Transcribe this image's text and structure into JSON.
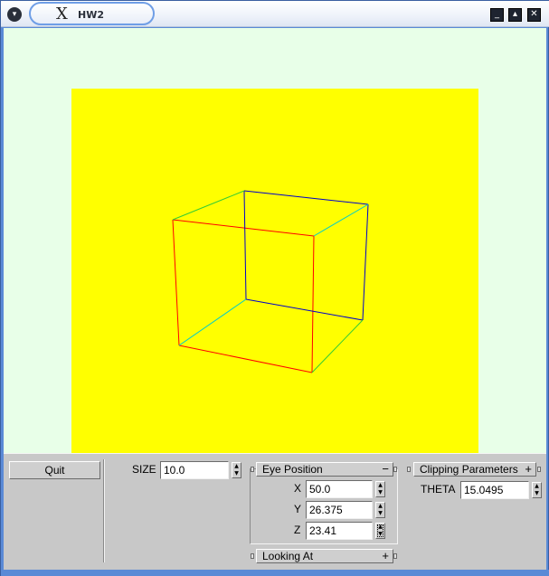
{
  "window": {
    "title": "HW2",
    "x_logo": "X",
    "menu_glyph": "▾",
    "min_glyph": "_",
    "max_glyph": "▴",
    "close_glyph": "✕"
  },
  "colors": {
    "background": "#e8ffe8",
    "viewport": "#ffff00",
    "edge_red": "#ff0000",
    "edge_blue": "#0000cc",
    "edge_green": "#33cc33",
    "edge_cyan": "#00cccc"
  },
  "controls": {
    "quit_label": "Quit",
    "size_label": "SIZE",
    "size_value": "10.0",
    "eye_position": {
      "title": "Eye Position",
      "sign": "−",
      "x_label": "X",
      "x_value": "50.0",
      "y_label": "Y",
      "y_value": "26.375",
      "z_label": "Z",
      "z_value": "23.41"
    },
    "looking_at": {
      "title": "Looking At",
      "sign": "+"
    },
    "clipping": {
      "title": "Clipping Parameters",
      "sign": "+",
      "theta_label": "THETA",
      "theta_value": "15.0495"
    },
    "spin_glyph": "▲▼"
  }
}
